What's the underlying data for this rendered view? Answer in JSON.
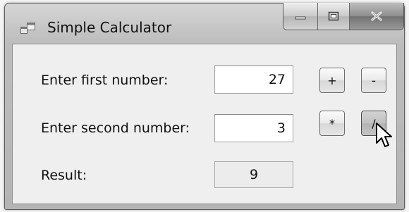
{
  "window": {
    "title": "Simple Calculator",
    "app_icon": "window-app-icon",
    "caption_buttons": [
      "minimize-icon",
      "maximize-icon",
      "close-icon"
    ]
  },
  "form": {
    "first_label": "Enter first number:",
    "first_value": "27",
    "second_label": "Enter second number:",
    "second_value": "3",
    "result_label": "Result:",
    "result_value": "9"
  },
  "operators": {
    "add": "+",
    "subtract": "-",
    "multiply": "*",
    "divide": "/"
  },
  "cursor": "mouse-pointer-icon"
}
